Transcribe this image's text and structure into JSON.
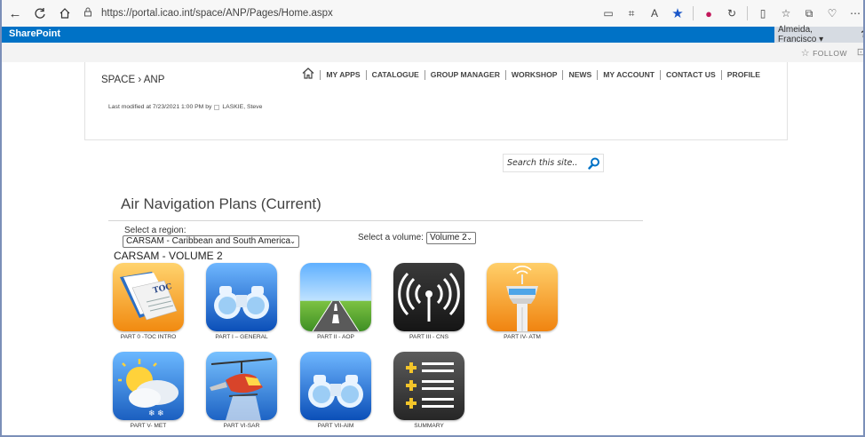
{
  "browser": {
    "url": "https://portal.icao.int/space/ANP/Pages/Home.aspx",
    "icons": [
      "back-icon",
      "refresh-icon",
      "home-icon",
      "lock-icon",
      "reader-icon",
      "grid-icon",
      "read-aloud-icon",
      "favorite-star-icon",
      "extension-icon",
      "copilot-icon",
      "split-icon",
      "favorites-icon",
      "collections-icon",
      "heart-icon",
      "more-icon"
    ]
  },
  "sharepoint": {
    "brand": "SharePoint",
    "user": "Almeida, Francisco ▾",
    "help": "?",
    "follow": "FOLLOW"
  },
  "header": {
    "breadcrumb": "SPACE › ANP",
    "last_modified": "Last modified at 7/23/2021 1:00 PM by",
    "modified_by": "LASKIE, Steve",
    "nav": [
      "MY APPS",
      "CATALOGUE",
      "GROUP MANAGER",
      "WORKSHOP",
      "NEWS",
      "MY ACCOUNT",
      "CONTACT US",
      "PROFILE"
    ]
  },
  "search": {
    "placeholder": "Search this site.."
  },
  "main": {
    "title": "Air Navigation Plans (Current)",
    "region_label": "Select a region:",
    "region_value": "CARSAM - Caribbean and South America",
    "volume_label": "Select a volume:",
    "volume_value": "Volume 2",
    "section_heading": "CARSAM - VOLUME 2",
    "tiles": [
      {
        "label": "PART 0 -TOC INTRO",
        "icon": "toc-book-icon"
      },
      {
        "label": "PART I – GENERAL",
        "icon": "binoculars-icon"
      },
      {
        "label": "PART II - AOP",
        "icon": "runway-icon"
      },
      {
        "label": "PART III - CNS",
        "icon": "antenna-signal-icon"
      },
      {
        "label": "PART IV- ATM",
        "icon": "control-tower-icon"
      },
      {
        "label": "PART V- MET",
        "icon": "weather-icon"
      },
      {
        "label": "PART VI-SAR",
        "icon": "helicopter-icon"
      },
      {
        "label": "PART VII-AIM",
        "icon": "binoculars-icon"
      },
      {
        "label": "SUMMARY",
        "icon": "summary-list-icon"
      }
    ]
  }
}
